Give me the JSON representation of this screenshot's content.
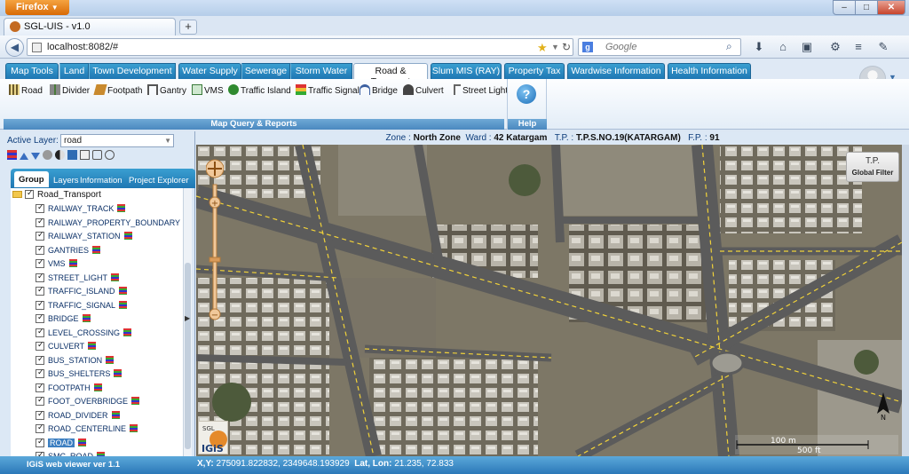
{
  "browser": {
    "menu_label": "Firefox",
    "tab_title": "SGL-UIS - v1.0",
    "new_tab": "+",
    "url": "localhost:8082/#",
    "search_placeholder": "Google",
    "controls": {
      "minimize": "–",
      "maximize": "□",
      "close": "✕"
    }
  },
  "app_tabs": [
    {
      "label": "Map Tools"
    },
    {
      "label": "Land"
    },
    {
      "label": "Town Development"
    },
    {
      "label": "Water Supply"
    },
    {
      "label": "Sewerage"
    },
    {
      "label": "Storm Water"
    },
    {
      "label": "Road & Transport",
      "active": true
    },
    {
      "label": "Slum MIS (RAY)"
    },
    {
      "label": "Property Tax"
    },
    {
      "label": "Wardwise Information"
    },
    {
      "label": "Health Information"
    }
  ],
  "ribbon": {
    "items": [
      {
        "label": "Road",
        "icon": "road-icon",
        "color": "#6b5a2a"
      },
      {
        "label": "Divider",
        "icon": "divider-icon",
        "color": "#4a7a3a"
      },
      {
        "label": "Footpath",
        "icon": "footpath-icon",
        "color": "#c98a2e"
      },
      {
        "label": "Gantry",
        "icon": "gantry-icon",
        "color": "#555555"
      },
      {
        "label": "VMS",
        "icon": "vms-icon",
        "color": "#3a7a3a"
      },
      {
        "label": "Traffic Island",
        "icon": "traffic-island-icon",
        "color": "#2f8a2f"
      },
      {
        "label": "Traffic Signal",
        "icon": "traffic-signal-icon",
        "color": "#b8452b"
      },
      {
        "label": "Bridge",
        "icon": "bridge-icon",
        "color": "#3b5fa0"
      },
      {
        "label": "Culvert",
        "icon": "culvert-icon",
        "color": "#444444"
      },
      {
        "label": "Street Light",
        "icon": "street-light-icon",
        "color": "#666666"
      }
    ],
    "group_label": "Map Query & Reports",
    "help_label": "Help",
    "help_glyph": "?"
  },
  "left_panel": {
    "active_layer_label": "Active Layer:",
    "active_layer_value": "road",
    "tabs": [
      "Group",
      "Layers",
      "Information",
      "Project Explorer"
    ],
    "tree_root": "Road_Transport",
    "layers": [
      "RAILWAY_TRACK",
      "RAILWAY_PROPERTY_BOUNDARY",
      "RAILWAY_STATION",
      "GANTRIES",
      "VMS",
      "STREET_LIGHT",
      "TRAFFIC_ISLAND",
      "TRAFFIC_SIGNAL",
      "BRIDGE",
      "LEVEL_CROSSING",
      "CULVERT",
      "BUS_STATION",
      "BUS_SHELTERS",
      "FOOTPATH",
      "FOOT_OVERBRIDGE",
      "ROAD_DIVIDER",
      "ROAD_CENTERLINE",
      "ROAD",
      "SMC_ROAD"
    ],
    "selected_layer": "ROAD"
  },
  "map_header": {
    "zone_label": "Zone :",
    "zone_value": "North Zone",
    "ward_label": "Ward :",
    "ward_value": "42 Katargam",
    "tp_label": "T.P. :",
    "tp_value": "T.P.S.NO.19(KATARGAM)",
    "fp_label": "F.P. :",
    "fp_value": "91"
  },
  "global_filter": {
    "title": "T.P.",
    "label": "Global Filter"
  },
  "logo": {
    "text_top": "SGL",
    "text_main": "IGiS"
  },
  "scale": {
    "label_m": "100 m",
    "label_ft": "500 ft"
  },
  "north": "N",
  "status": {
    "version": "IGiS web viewer ver 1.1",
    "xy_label": "X,Y:",
    "xy_value": "275091.822832, 2349648.193929",
    "latlon_label": "Lat, Lon:",
    "latlon_value": "21.235, 72.833"
  },
  "colors": {
    "tab_blue": "#1f77b3",
    "road_gray": "#5b5b5b",
    "road_dash": "#f1d23a",
    "status_blue": "#2b78b8"
  }
}
